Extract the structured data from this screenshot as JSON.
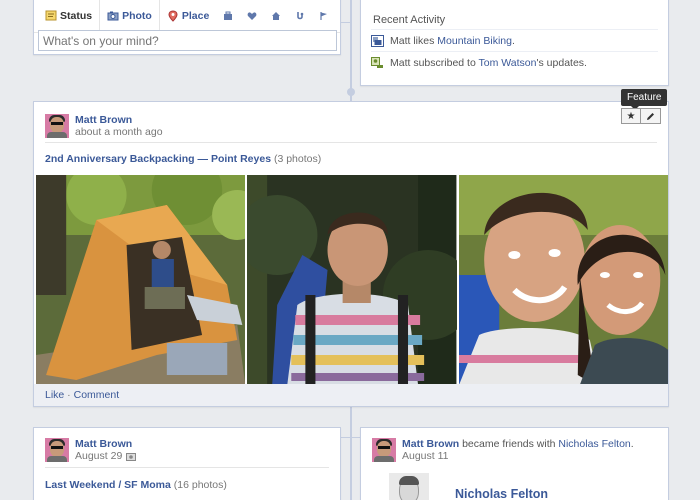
{
  "composer": {
    "tabs": [
      {
        "label": "Status",
        "icon": "status-icon"
      },
      {
        "label": "Photo",
        "icon": "camera-icon"
      },
      {
        "label": "Place",
        "icon": "place-pin-icon"
      }
    ],
    "life_event_icons": [
      "work-icon",
      "heart-icon",
      "home-icon",
      "health-icon",
      "flag-icon"
    ],
    "placeholder": "What's on your mind?"
  },
  "recent_activity": {
    "title": "Recent Activity",
    "items": [
      {
        "actor": "Matt",
        "verb": "likes",
        "object": "Mountain Biking",
        "suffix": ".",
        "icon": "like-page-icon"
      },
      {
        "actor": "Matt",
        "verb": "subscribed to",
        "object": "Tom Watson",
        "suffix": "'s updates.",
        "icon": "subscribe-icon"
      }
    ]
  },
  "feature": {
    "tooltip": "Feature",
    "star_icon": "star-icon",
    "edit_icon": "pencil-icon"
  },
  "post": {
    "author": "Matt Brown",
    "time": "about a month ago",
    "album_title": "2nd Anniversary Backpacking",
    "separator": " — ",
    "location": "Point Reyes",
    "count": " (3 photos)",
    "photos": [
      "tent-campsite-photo",
      "hiker-portrait-photo",
      "couple-selfie-photo"
    ],
    "like": "Like",
    "dot": " · ",
    "comment": "Comment"
  },
  "card_left": {
    "author": "Matt Brown",
    "time": "August 29",
    "album_title": "Last Weekend / SF Moma",
    "count": " (16 photos)"
  },
  "card_right": {
    "author": "Matt Brown",
    "verb": " became friends with ",
    "friend": "Nicholas Felton",
    "suffix": ".",
    "time": "August 11",
    "friend_name": "Nicholas Felton"
  },
  "colors": {
    "link": "#3b5998",
    "background": "#e9ebee",
    "border": "#c4cde0"
  }
}
